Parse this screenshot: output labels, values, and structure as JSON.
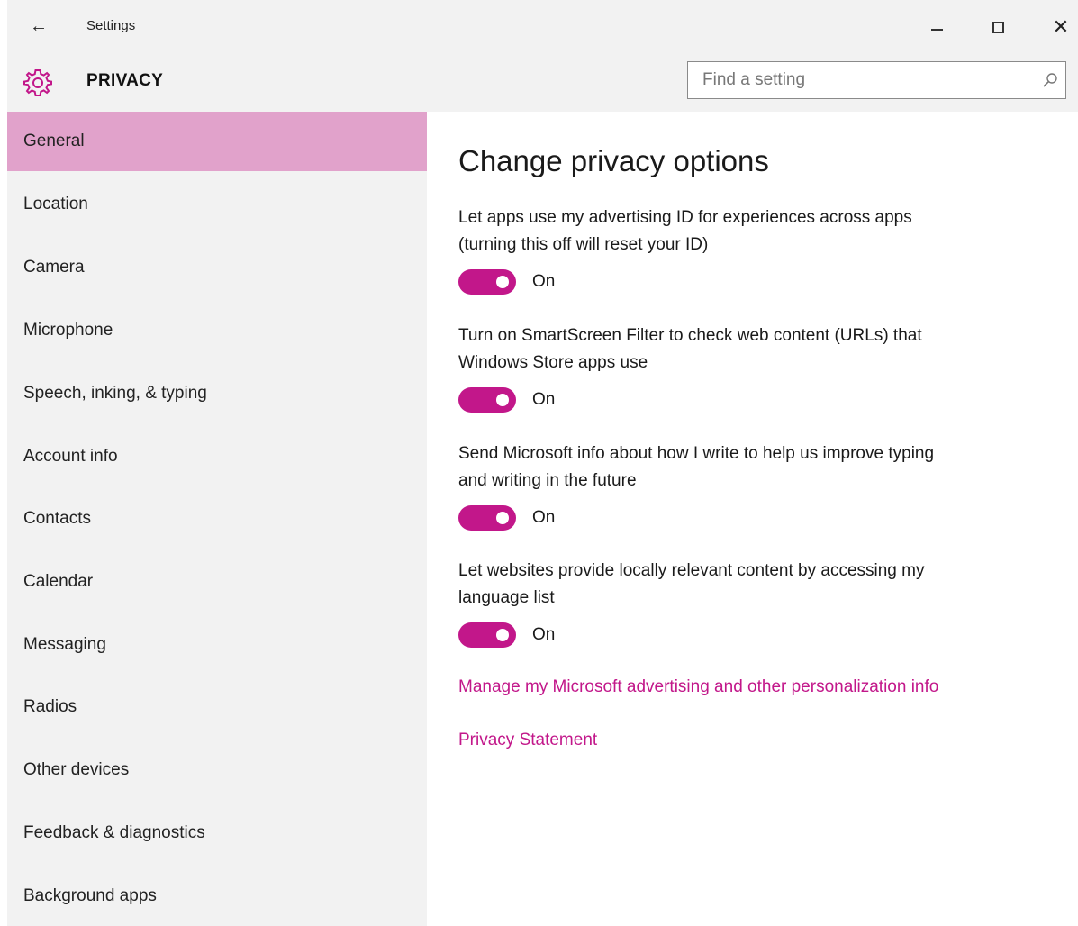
{
  "window": {
    "app_title": "Settings",
    "back_icon": "arrow-left-icon",
    "controls": [
      "minimize-icon",
      "maximize-icon",
      "close-icon"
    ]
  },
  "header": {
    "icon": "gear-icon",
    "section_title": "PRIVACY",
    "search_placeholder": "Find a setting"
  },
  "sidebar": {
    "items": [
      {
        "label": "General",
        "active": true
      },
      {
        "label": "Location",
        "active": false
      },
      {
        "label": "Camera",
        "active": false
      },
      {
        "label": "Microphone",
        "active": false
      },
      {
        "label": "Speech, inking, & typing",
        "active": false
      },
      {
        "label": "Account info",
        "active": false
      },
      {
        "label": "Contacts",
        "active": false
      },
      {
        "label": "Calendar",
        "active": false
      },
      {
        "label": "Messaging",
        "active": false
      },
      {
        "label": "Radios",
        "active": false
      },
      {
        "label": "Other devices",
        "active": false
      },
      {
        "label": "Feedback & diagnostics",
        "active": false
      },
      {
        "label": "Background apps",
        "active": false
      }
    ]
  },
  "main": {
    "heading": "Change privacy options",
    "options": [
      {
        "line1": "Let apps use my advertising ID for experiences across apps",
        "line2": "(turning this off will reset your ID)",
        "state": "On"
      },
      {
        "line1": "Turn on SmartScreen Filter to check web content (URLs) that",
        "line2": "Windows Store apps use",
        "state": "On"
      },
      {
        "line1": "Send Microsoft info about how I write to help us improve typing",
        "line2": "and writing in the future",
        "state": "On"
      },
      {
        "line1": "Let websites provide locally relevant content by accessing my",
        "line2": "language list",
        "state": "On"
      }
    ],
    "links": {
      "manage": "Manage my Microsoft advertising and other personalization info",
      "privacy_statement": "Privacy Statement"
    }
  },
  "colors": {
    "accent": "#c2178a",
    "selection": "#e1a2cb",
    "chrome": "#f2f2f2"
  }
}
